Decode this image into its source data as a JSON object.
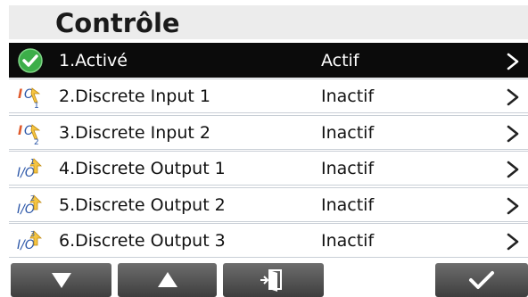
{
  "header": {
    "title": "Contrôle"
  },
  "items": [
    {
      "label": "1.Activé",
      "status": "Actif",
      "icon": "check-circle-icon",
      "selected": true
    },
    {
      "label": "2.Discrete Input 1",
      "status": "Inactif",
      "icon": "discrete-input-icon",
      "selected": false
    },
    {
      "label": "3.Discrete Input 2",
      "status": "Inactif",
      "icon": "discrete-input-icon",
      "selected": false
    },
    {
      "label": "4.Discrete Output 1",
      "status": "Inactif",
      "icon": "discrete-output-icon",
      "selected": false
    },
    {
      "label": "5.Discrete Output 2",
      "status": "Inactif",
      "icon": "discrete-output-icon",
      "selected": false
    },
    {
      "label": "6.Discrete Output 3",
      "status": "Inactif",
      "icon": "discrete-output-icon",
      "selected": false
    }
  ],
  "footer": {
    "buttons": [
      {
        "name": "down-arrow-button",
        "icon": "down-arrow-icon"
      },
      {
        "name": "up-arrow-button",
        "icon": "up-arrow-icon"
      },
      {
        "name": "exit-button",
        "icon": "exit-door-icon"
      },
      {
        "name": "confirm-button",
        "icon": "check-icon"
      }
    ]
  },
  "colors": {
    "selected_row": "#0b0b0b",
    "title_bar": "#ececec",
    "check_green": "#3cae49",
    "button_gray": "#555555"
  }
}
